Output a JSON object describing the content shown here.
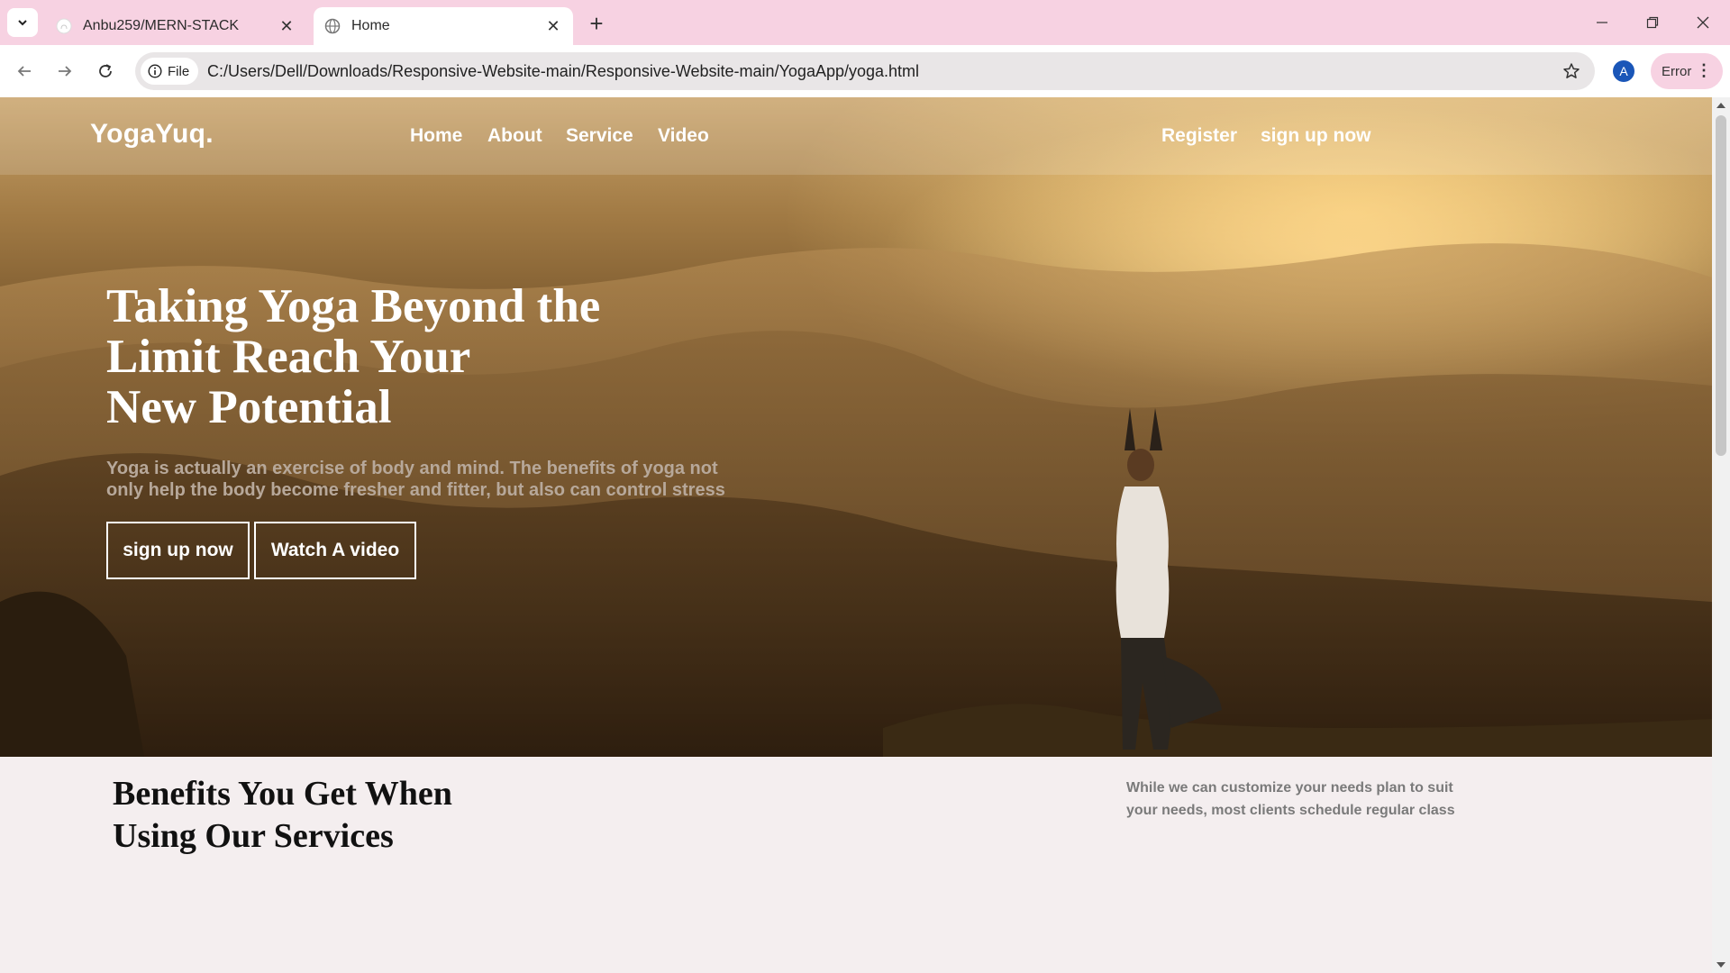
{
  "browser": {
    "tabs": [
      {
        "title": "Anbu259/MERN-STACK",
        "active": false,
        "icon": "github-icon"
      },
      {
        "title": "Home",
        "active": true,
        "icon": "globe-icon"
      }
    ],
    "site_chip_label": "File",
    "url": "C:/Users/Dell/Downloads/Responsive-Website-main/Responsive-Website-main/YogaApp/yoga.html",
    "profile_initial": "A",
    "error_label": "Error",
    "tabbar_color": "#f7d2e2"
  },
  "page": {
    "brand": "YogaYuq.",
    "nav": {
      "home": "Home",
      "about": "About",
      "service": "Service",
      "video": "Video",
      "register": "Register",
      "signup": "sign up now"
    },
    "hero": {
      "headline_lines": [
        "Taking Yoga Beyond the",
        "Limit Reach Your",
        "New Potential"
      ],
      "subtext": "Yoga is actually an exercise of body and mind. The benefits of yoga not only help the body become fresher and fitter, but also can control stress",
      "btn_signup": "sign up now",
      "btn_video": "Watch A video"
    },
    "benefits": {
      "title_lines": [
        "Benefits You Get When",
        "Using Our Services"
      ],
      "note": "While we can customize your needs plan to suit your needs, most clients schedule regular class"
    }
  }
}
